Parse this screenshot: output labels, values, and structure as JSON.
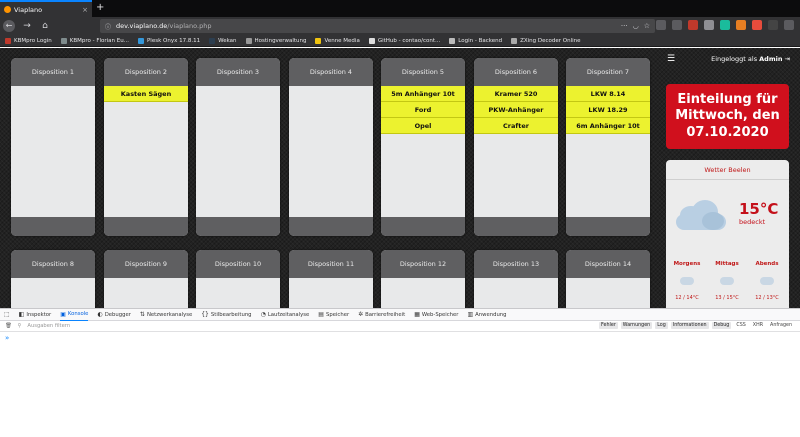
{
  "browser": {
    "tab_title": "Viaplano",
    "close_glyph": "×",
    "new_tab_glyph": "+",
    "url_host": "dev.viaplano.de",
    "url_path": "/viaplano.php",
    "bookmarks": [
      {
        "label": "KBMpro Login",
        "color": "#c0392b"
      },
      {
        "label": "KBMpro - Florian Eu...",
        "color": "#7f8c8d"
      },
      {
        "label": "Plesk Onyx 17.8.11",
        "color": "#3498db"
      },
      {
        "label": "Wekan",
        "color": "#2c3e50"
      },
      {
        "label": "Hostingverwaltung",
        "color": "#999999"
      },
      {
        "label": "Venne Media",
        "color": "#f1c40f"
      },
      {
        "label": "GitHub - contao/cont...",
        "color": "#dddddd"
      },
      {
        "label": "Login - Backend",
        "color": "#bbbbbb"
      },
      {
        "label": "ZXing Decoder Online",
        "color": "#aaaaaa"
      }
    ]
  },
  "dispositions": [
    {
      "label": "Disposition 1",
      "items": []
    },
    {
      "label": "Disposition 2",
      "items": [
        "Kasten Sägen"
      ]
    },
    {
      "label": "Disposition 3",
      "items": []
    },
    {
      "label": "Disposition 4",
      "items": []
    },
    {
      "label": "Disposition 5",
      "items": [
        "5m Anhänger 10t",
        "Ford",
        "Opel"
      ]
    },
    {
      "label": "Disposition 6",
      "items": [
        "Kramer 520",
        "PKW-Anhänger",
        "Crafter"
      ]
    },
    {
      "label": "Disposition 7",
      "items": [
        "LKW 8.14",
        "LKW 18.29",
        "6m Anhänger 10t"
      ]
    },
    {
      "label": "Disposition 8",
      "items": []
    },
    {
      "label": "Disposition 9",
      "items": []
    },
    {
      "label": "Disposition 10",
      "items": []
    },
    {
      "label": "Disposition 11",
      "items": []
    },
    {
      "label": "Disposition 12",
      "items": []
    },
    {
      "label": "Disposition 13",
      "items": []
    },
    {
      "label": "Disposition 14",
      "items": []
    }
  ],
  "sidebar": {
    "menu_glyph": "☰",
    "login_prefix": "Eingeloggt als",
    "login_user": "Admin",
    "login_suffix": "⇥",
    "einteilung": "Einteilung für Mittwoch, den 07.10.2020"
  },
  "weather": {
    "location": "Wetter Beelen",
    "temperature": "15°C",
    "condition": "bedeckt",
    "forecast": [
      {
        "label": "Morgens",
        "temp": "12 / 14°C"
      },
      {
        "label": "Mittags",
        "temp": "13 / 15°C"
      },
      {
        "label": "Abends",
        "temp": "12 / 13°C"
      }
    ]
  },
  "devtools": {
    "tabs": [
      {
        "label": "Inspektor",
        "icon": "inspector-icon",
        "glyph": "◧"
      },
      {
        "label": "Konsole",
        "icon": "console-icon",
        "glyph": "▣",
        "active": true
      },
      {
        "label": "Debugger",
        "icon": "debugger-icon",
        "glyph": "◐"
      },
      {
        "label": "Netzwerkanalyse",
        "icon": "network-icon",
        "glyph": "⇅"
      },
      {
        "label": "Stilbearbeitung",
        "icon": "style-editor-icon",
        "glyph": "{}"
      },
      {
        "label": "Laufzeitanalyse",
        "icon": "performance-icon",
        "glyph": "◔"
      },
      {
        "label": "Speicher",
        "icon": "memory-icon",
        "glyph": "▤"
      },
      {
        "label": "Barrierefreiheit",
        "icon": "accessibility-icon",
        "glyph": "✲"
      },
      {
        "label": "Web-Speicher",
        "icon": "storage-icon",
        "glyph": "▦"
      },
      {
        "label": "Anwendung",
        "icon": "application-icon",
        "glyph": "▥"
      }
    ],
    "filter_placeholder": "Ausgaben filtern",
    "filters": [
      "Fehler",
      "Warnungen",
      "Log",
      "Informationen",
      "Debug"
    ],
    "extra_filters": [
      "CSS",
      "XHR",
      "Anfragen"
    ],
    "prompt": "»"
  }
}
